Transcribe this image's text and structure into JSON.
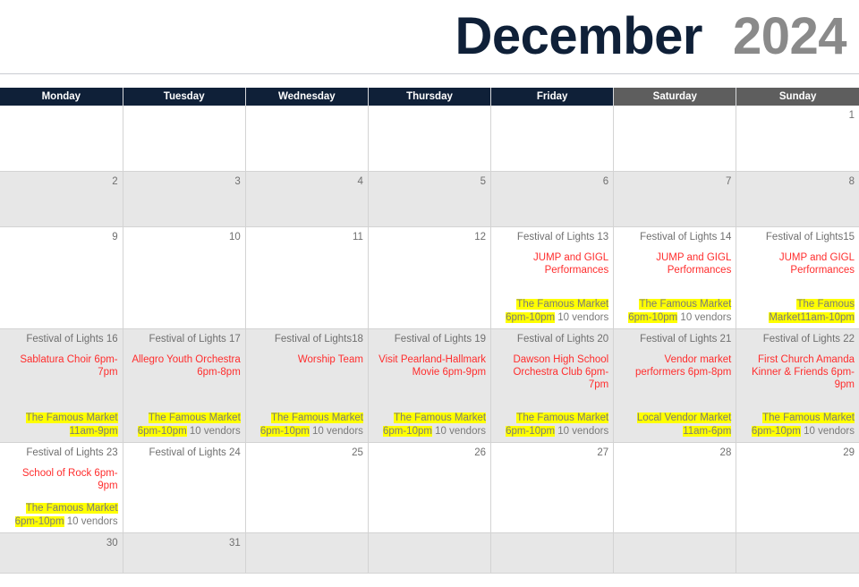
{
  "header": {
    "month": "December",
    "year": "2024"
  },
  "weekday_headers": [
    {
      "label": "Monday",
      "weekend": false
    },
    {
      "label": "Tuesday",
      "weekend": false
    },
    {
      "label": "Wednesday",
      "weekend": false
    },
    {
      "label": "Thursday",
      "weekend": false
    },
    {
      "label": "Friday",
      "weekend": false
    },
    {
      "label": "Saturday",
      "weekend": true
    },
    {
      "label": "Sunday",
      "weekend": true
    }
  ],
  "colors": {
    "header_navy": "#0f2038",
    "header_weekend_gray": "#5e5e5e",
    "event_red": "#ff2d2d",
    "highlight_yellow": "#ffff00",
    "daynum_gray": "#6f6f6f",
    "row_shade": "#e7e7e7",
    "year_gray": "#8a8a8a"
  },
  "weeks": [
    {
      "shaded": false,
      "days": [
        {
          "daynum_line": ""
        },
        {
          "daynum_line": ""
        },
        {
          "daynum_line": ""
        },
        {
          "daynum_line": ""
        },
        {
          "daynum_line": ""
        },
        {
          "daynum_line": ""
        },
        {
          "daynum_line": "1"
        }
      ]
    },
    {
      "shaded": true,
      "days": [
        {
          "daynum_line": "2"
        },
        {
          "daynum_line": "3"
        },
        {
          "daynum_line": "4"
        },
        {
          "daynum_line": "5"
        },
        {
          "daynum_line": "6"
        },
        {
          "daynum_line": "7"
        },
        {
          "daynum_line": "8"
        }
      ]
    },
    {
      "shaded": false,
      "days": [
        {
          "daynum_line": "9"
        },
        {
          "daynum_line": "10"
        },
        {
          "daynum_line": "11"
        },
        {
          "daynum_line": "12"
        },
        {
          "daynum_line": "Festival of Lights 13",
          "event": "JUMP and GIGL Performances",
          "market_hl": "The Famous Market 6pm-10pm",
          "market_tail": " 10 vendors"
        },
        {
          "daynum_line": "Festival of Lights 14",
          "event": "JUMP and GIGL Performances",
          "market_hl": "The Famous Market 6pm-10pm",
          "market_tail": " 10 vendors"
        },
        {
          "daynum_line": "Festival of Lights15",
          "event": "JUMP and GIGL Performances",
          "market_hl": "The Famous Market11am-10pm",
          "market_tail": ""
        }
      ]
    },
    {
      "shaded": true,
      "days": [
        {
          "daynum_line": "Festival of Lights 16",
          "event": "Sablatura Choir 6pm-7pm",
          "market_hl": "The Famous Market 11am-9pm",
          "market_tail": ""
        },
        {
          "daynum_line": "Festival of Lights 17",
          "event": "Allegro Youth Orchestra 6pm-8pm",
          "market_hl": "The Famous Market 6pm-10pm",
          "market_tail": " 10 vendors"
        },
        {
          "daynum_line": "Festival of Lights18",
          "event": "Worship Team",
          "market_hl": "The Famous Market 6pm-10pm",
          "market_tail": " 10 vendors"
        },
        {
          "daynum_line": "Festival of Lights 19",
          "event": "Visit Pearland-Hallmark Movie 6pm-9pm",
          "market_hl": "The Famous Market 6pm-10pm",
          "market_tail": " 10 vendors"
        },
        {
          "daynum_line": "Festival of Lights 20",
          "event": "Dawson High School Orchestra Club 6pm-7pm",
          "market_hl": "The Famous Market 6pm-10pm",
          "market_tail": " 10 vendors"
        },
        {
          "daynum_line": "Festival of Lights 21",
          "event": "Vendor market performers 6pm-8pm",
          "market_hl": "Local Vendor Market 11am-6pm",
          "market_tail": ""
        },
        {
          "daynum_line": "Festival of Lights 22",
          "event": "First Church Amanda Kinner & Friends 6pm-9pm",
          "market_hl": "The Famous Market 6pm-10pm",
          "market_tail": " 10 vendors"
        }
      ]
    },
    {
      "shaded": false,
      "days": [
        {
          "daynum_line": "Festival of Lights 23",
          "event": "School of Rock 6pm-9pm",
          "market_hl": "The Famous Market 6pm-10pm",
          "market_tail": " 10 vendors"
        },
        {
          "daynum_line": "Festival of Lights 24"
        },
        {
          "daynum_line": "25"
        },
        {
          "daynum_line": "26"
        },
        {
          "daynum_line": "27"
        },
        {
          "daynum_line": "28"
        },
        {
          "daynum_line": "29"
        }
      ]
    },
    {
      "shaded": true,
      "days": [
        {
          "daynum_line": "30"
        },
        {
          "daynum_line": "31"
        },
        {
          "daynum_line": ""
        },
        {
          "daynum_line": ""
        },
        {
          "daynum_line": ""
        },
        {
          "daynum_line": ""
        },
        {
          "daynum_line": ""
        }
      ]
    }
  ]
}
